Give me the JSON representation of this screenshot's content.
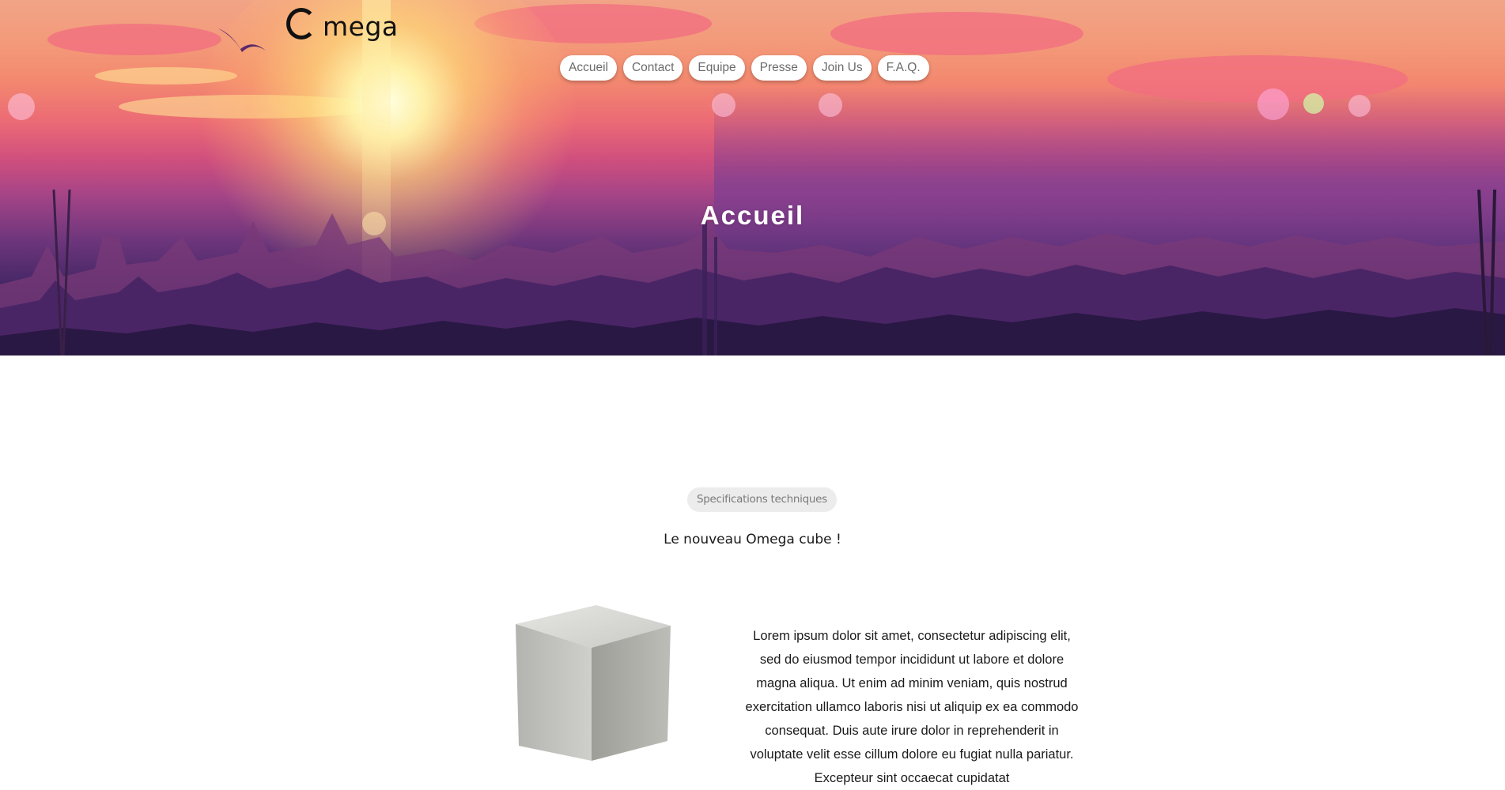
{
  "logo": {
    "text": "mega",
    "icon": "bird-icon"
  },
  "nav": {
    "items": [
      "Accueil",
      "Contact",
      "Equipe",
      "Presse",
      "Join Us",
      "F.A.Q."
    ]
  },
  "hero": {
    "title": "Accueil"
  },
  "section": {
    "badge": "Specifications techniques",
    "subtitle": "Le nouveau Omega cube !",
    "body": "Lorem ipsum dolor sit amet, consectetur adipiscing elit, sed do eiusmod tempor incididunt ut labore et dolore magna aliqua. Ut enim ad minim veniam, quis nostrud exercitation ullamco laboris nisi ut aliquip ex ea commodo consequat. Duis aute irure dolor in reprehenderit in voluptate velit esse cillum dolore eu fugiat nulla pariatur. Excepteur sint occaecat cupidatat"
  },
  "colors": {
    "nav_text": "#6b6b6b",
    "badge_bg": "#ececec",
    "hero_title": "#ffffff"
  }
}
